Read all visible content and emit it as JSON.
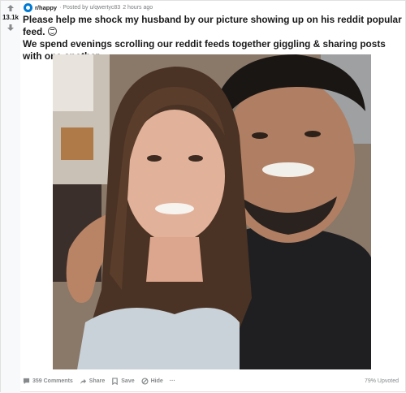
{
  "vote": {
    "score": "13.1k"
  },
  "meta": {
    "subreddit": "r/happy",
    "posted_by": "· Posted by u/qwertyc83",
    "time": "2 hours ago"
  },
  "post": {
    "title": "Please help me shock my husband by our picture showing up on his reddit popular feed.",
    "title_cont": "We spend evenings scrolling our reddit feeds together giggling & sharing posts with one another."
  },
  "footer": {
    "comments": "359 Comments",
    "share": "Share",
    "save": "Save",
    "hide": "Hide",
    "more": "···",
    "upvoted": "79% Upvoted"
  },
  "colors": {
    "upvote": "#878a8c",
    "subreddit_icon": "#0079d3",
    "vote_bar": "#f8f9fa"
  }
}
